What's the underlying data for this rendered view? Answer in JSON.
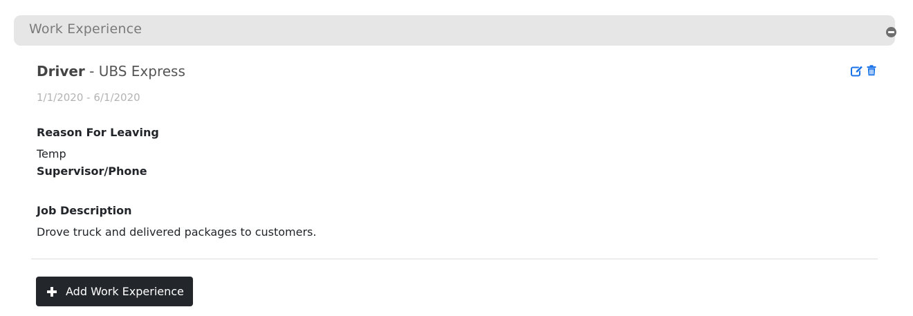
{
  "section": {
    "title": "Work Experience",
    "collapse_icon": "minus-circle-icon"
  },
  "experience": {
    "position": "Driver",
    "separator": " - ",
    "company": "UBS Express",
    "dates": "1/1/2020 - 6/1/2020",
    "reason_label": "Reason For Leaving",
    "reason_value": "Temp",
    "supervisor_label": "Supervisor/Phone",
    "supervisor_value": "",
    "description_label": "Job Description",
    "description_value": "Drove truck and delivered packages to customers.",
    "edit_icon": "edit-icon",
    "delete_icon": "trash-icon",
    "icon_color": "#1a73e8"
  },
  "actions": {
    "add_label": "Add Work Experience",
    "add_icon": "plus-icon",
    "button_color": "#23272b"
  }
}
